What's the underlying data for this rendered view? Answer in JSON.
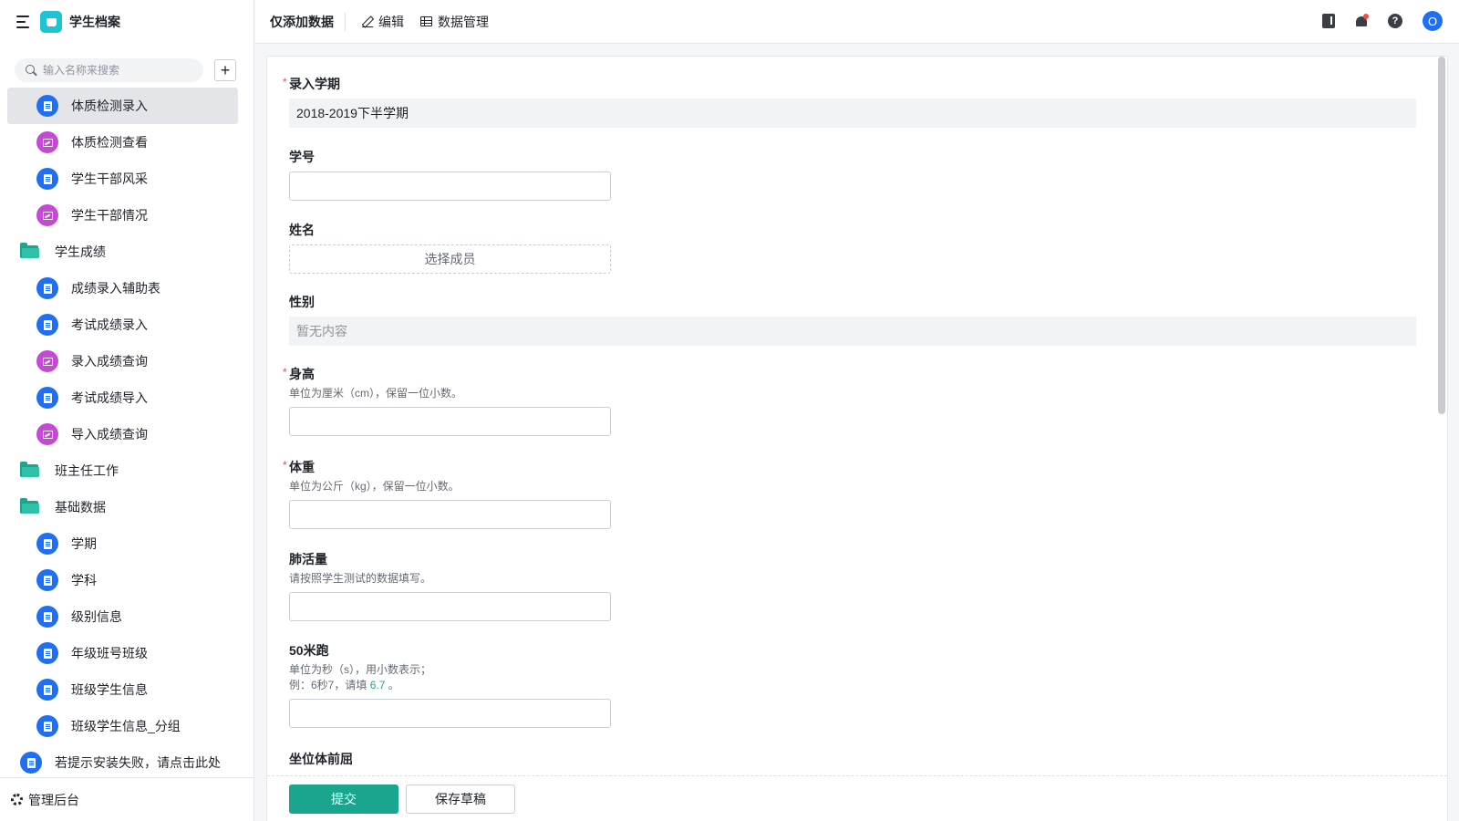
{
  "app": {
    "title": "学生档案"
  },
  "sidebar": {
    "search_placeholder": "输入名称来搜索",
    "add_label": "+",
    "items": [
      {
        "label": "体质检测录入",
        "type": "form",
        "level": 2,
        "active": true
      },
      {
        "label": "体质检测查看",
        "type": "report",
        "level": 2
      },
      {
        "label": "学生干部风采",
        "type": "form",
        "level": 2
      },
      {
        "label": "学生干部情况",
        "type": "report",
        "level": 2
      },
      {
        "label": "学生成绩",
        "type": "folder",
        "level": 1
      },
      {
        "label": "成绩录入辅助表",
        "type": "form",
        "level": 2
      },
      {
        "label": "考试成绩录入",
        "type": "form",
        "level": 2
      },
      {
        "label": "录入成绩查询",
        "type": "report",
        "level": 2
      },
      {
        "label": "考试成绩导入",
        "type": "form",
        "level": 2
      },
      {
        "label": "导入成绩查询",
        "type": "report",
        "level": 2
      },
      {
        "label": "班主任工作",
        "type": "folder",
        "level": 1
      },
      {
        "label": "基础数据",
        "type": "folder",
        "level": 1
      },
      {
        "label": "学期",
        "type": "form",
        "level": 2
      },
      {
        "label": "学科",
        "type": "form",
        "level": 2
      },
      {
        "label": "级别信息",
        "type": "form",
        "level": 2
      },
      {
        "label": "年级班号班级",
        "type": "form",
        "level": 2
      },
      {
        "label": "班级学生信息",
        "type": "form",
        "level": 2
      },
      {
        "label": "班级学生信息_分组",
        "type": "form",
        "level": 2
      },
      {
        "label": "若提示安装失败，请点击此处",
        "type": "form",
        "level": 1
      }
    ],
    "footer_label": "管理后台"
  },
  "topbar": {
    "title": "仅添加数据",
    "edit_label": "编辑",
    "data_manage_label": "数据管理",
    "avatar_letter": "O",
    "help_glyph": "?"
  },
  "form": {
    "term": {
      "label": "录入学期",
      "value": "2018-2019下半学期"
    },
    "student_id": {
      "label": "学号",
      "value": ""
    },
    "name": {
      "label": "姓名",
      "button": "选择成员"
    },
    "gender": {
      "label": "性别",
      "value": "暂无内容"
    },
    "height": {
      "label": "身高",
      "hint": "单位为厘米（cm），保留一位小数。",
      "value": ""
    },
    "weight": {
      "label": "体重",
      "hint": "单位为公斤（kg），保留一位小数。",
      "value": ""
    },
    "lung": {
      "label": "肺活量",
      "hint": "请按照学生测试的数据填写。",
      "value": ""
    },
    "run50": {
      "label": "50米跑",
      "hint1": "单位为秒（s），用小数表示；",
      "hint2_pre": "例：6秒7，请填 ",
      "hint2_em": "6.7",
      "hint2_post": " 。",
      "value": ""
    },
    "sit_reach": {
      "label": "坐位体前屈"
    },
    "required_mark": "*"
  },
  "footer": {
    "submit_label": "提交",
    "draft_label": "保存草稿"
  }
}
